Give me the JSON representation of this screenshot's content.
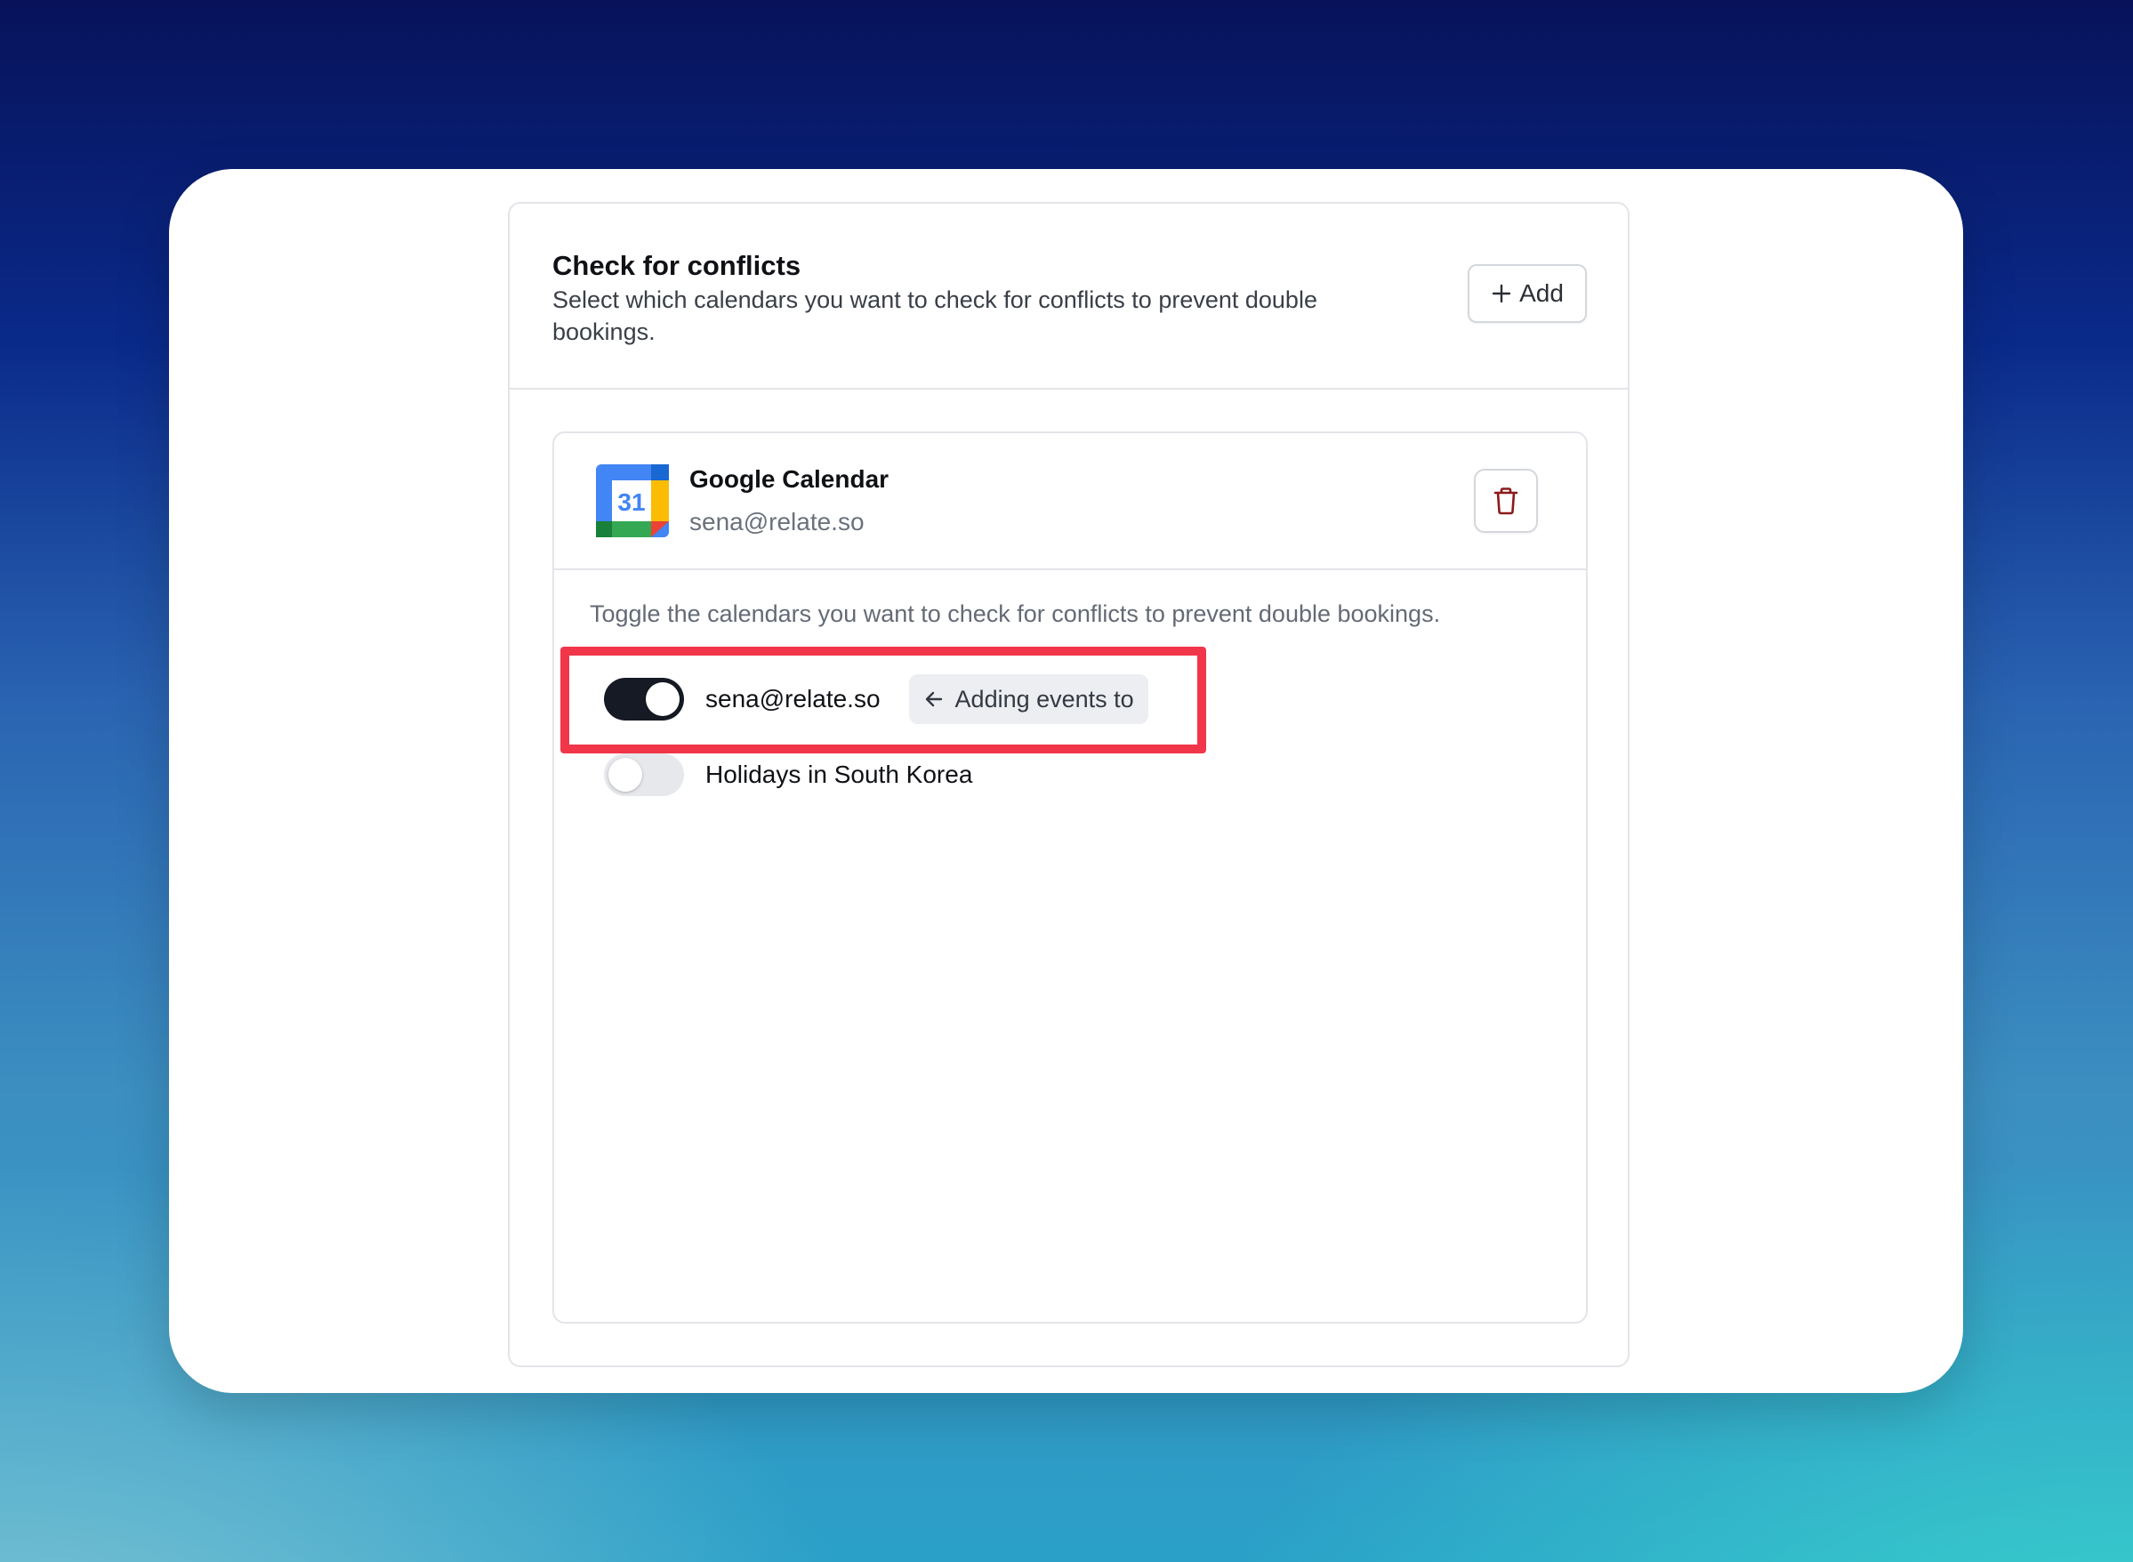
{
  "section": {
    "title": "Check for conflicts",
    "description": "Select which calendars you want to check for conflicts to prevent double bookings.",
    "add_label": "Add"
  },
  "calendar_account": {
    "provider": "Google Calendar",
    "icon_day": "31",
    "email": "sena@relate.so",
    "hint": "Toggle the calendars you want to check for conflicts to prevent double bookings.",
    "calendars": [
      {
        "label": "sena@relate.so",
        "enabled": true,
        "badge": "Adding events to"
      },
      {
        "label": "Holidays in South Korea",
        "enabled": false
      }
    ]
  },
  "colors": {
    "highlight": "#f2364a",
    "toggle_on": "#151a24",
    "toggle_off": "#e6e8ec",
    "delete_icon": "#8b1a1a"
  }
}
